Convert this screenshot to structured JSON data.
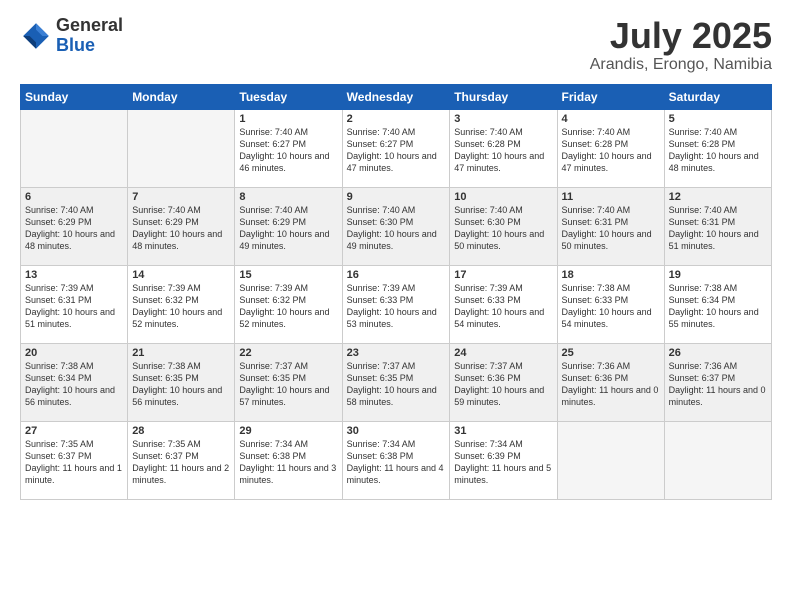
{
  "logo": {
    "general": "General",
    "blue": "Blue"
  },
  "title": "July 2025",
  "location": "Arandis, Erongo, Namibia",
  "days_header": [
    "Sunday",
    "Monday",
    "Tuesday",
    "Wednesday",
    "Thursday",
    "Friday",
    "Saturday"
  ],
  "weeks": [
    [
      {
        "day": "",
        "info": ""
      },
      {
        "day": "",
        "info": ""
      },
      {
        "day": "1",
        "info": "Sunrise: 7:40 AM\nSunset: 6:27 PM\nDaylight: 10 hours\nand 46 minutes."
      },
      {
        "day": "2",
        "info": "Sunrise: 7:40 AM\nSunset: 6:27 PM\nDaylight: 10 hours\nand 47 minutes."
      },
      {
        "day": "3",
        "info": "Sunrise: 7:40 AM\nSunset: 6:28 PM\nDaylight: 10 hours\nand 47 minutes."
      },
      {
        "day": "4",
        "info": "Sunrise: 7:40 AM\nSunset: 6:28 PM\nDaylight: 10 hours\nand 47 minutes."
      },
      {
        "day": "5",
        "info": "Sunrise: 7:40 AM\nSunset: 6:28 PM\nDaylight: 10 hours\nand 48 minutes."
      }
    ],
    [
      {
        "day": "6",
        "info": "Sunrise: 7:40 AM\nSunset: 6:29 PM\nDaylight: 10 hours\nand 48 minutes."
      },
      {
        "day": "7",
        "info": "Sunrise: 7:40 AM\nSunset: 6:29 PM\nDaylight: 10 hours\nand 48 minutes."
      },
      {
        "day": "8",
        "info": "Sunrise: 7:40 AM\nSunset: 6:29 PM\nDaylight: 10 hours\nand 49 minutes."
      },
      {
        "day": "9",
        "info": "Sunrise: 7:40 AM\nSunset: 6:30 PM\nDaylight: 10 hours\nand 49 minutes."
      },
      {
        "day": "10",
        "info": "Sunrise: 7:40 AM\nSunset: 6:30 PM\nDaylight: 10 hours\nand 50 minutes."
      },
      {
        "day": "11",
        "info": "Sunrise: 7:40 AM\nSunset: 6:31 PM\nDaylight: 10 hours\nand 50 minutes."
      },
      {
        "day": "12",
        "info": "Sunrise: 7:40 AM\nSunset: 6:31 PM\nDaylight: 10 hours\nand 51 minutes."
      }
    ],
    [
      {
        "day": "13",
        "info": "Sunrise: 7:39 AM\nSunset: 6:31 PM\nDaylight: 10 hours\nand 51 minutes."
      },
      {
        "day": "14",
        "info": "Sunrise: 7:39 AM\nSunset: 6:32 PM\nDaylight: 10 hours\nand 52 minutes."
      },
      {
        "day": "15",
        "info": "Sunrise: 7:39 AM\nSunset: 6:32 PM\nDaylight: 10 hours\nand 52 minutes."
      },
      {
        "day": "16",
        "info": "Sunrise: 7:39 AM\nSunset: 6:33 PM\nDaylight: 10 hours\nand 53 minutes."
      },
      {
        "day": "17",
        "info": "Sunrise: 7:39 AM\nSunset: 6:33 PM\nDaylight: 10 hours\nand 54 minutes."
      },
      {
        "day": "18",
        "info": "Sunrise: 7:38 AM\nSunset: 6:33 PM\nDaylight: 10 hours\nand 54 minutes."
      },
      {
        "day": "19",
        "info": "Sunrise: 7:38 AM\nSunset: 6:34 PM\nDaylight: 10 hours\nand 55 minutes."
      }
    ],
    [
      {
        "day": "20",
        "info": "Sunrise: 7:38 AM\nSunset: 6:34 PM\nDaylight: 10 hours\nand 56 minutes."
      },
      {
        "day": "21",
        "info": "Sunrise: 7:38 AM\nSunset: 6:35 PM\nDaylight: 10 hours\nand 56 minutes."
      },
      {
        "day": "22",
        "info": "Sunrise: 7:37 AM\nSunset: 6:35 PM\nDaylight: 10 hours\nand 57 minutes."
      },
      {
        "day": "23",
        "info": "Sunrise: 7:37 AM\nSunset: 6:35 PM\nDaylight: 10 hours\nand 58 minutes."
      },
      {
        "day": "24",
        "info": "Sunrise: 7:37 AM\nSunset: 6:36 PM\nDaylight: 10 hours\nand 59 minutes."
      },
      {
        "day": "25",
        "info": "Sunrise: 7:36 AM\nSunset: 6:36 PM\nDaylight: 11 hours\nand 0 minutes."
      },
      {
        "day": "26",
        "info": "Sunrise: 7:36 AM\nSunset: 6:37 PM\nDaylight: 11 hours\nand 0 minutes."
      }
    ],
    [
      {
        "day": "27",
        "info": "Sunrise: 7:35 AM\nSunset: 6:37 PM\nDaylight: 11 hours\nand 1 minute."
      },
      {
        "day": "28",
        "info": "Sunrise: 7:35 AM\nSunset: 6:37 PM\nDaylight: 11 hours\nand 2 minutes."
      },
      {
        "day": "29",
        "info": "Sunrise: 7:34 AM\nSunset: 6:38 PM\nDaylight: 11 hours\nand 3 minutes."
      },
      {
        "day": "30",
        "info": "Sunrise: 7:34 AM\nSunset: 6:38 PM\nDaylight: 11 hours\nand 4 minutes."
      },
      {
        "day": "31",
        "info": "Sunrise: 7:34 AM\nSunset: 6:39 PM\nDaylight: 11 hours\nand 5 minutes."
      },
      {
        "day": "",
        "info": ""
      },
      {
        "day": "",
        "info": ""
      }
    ]
  ]
}
